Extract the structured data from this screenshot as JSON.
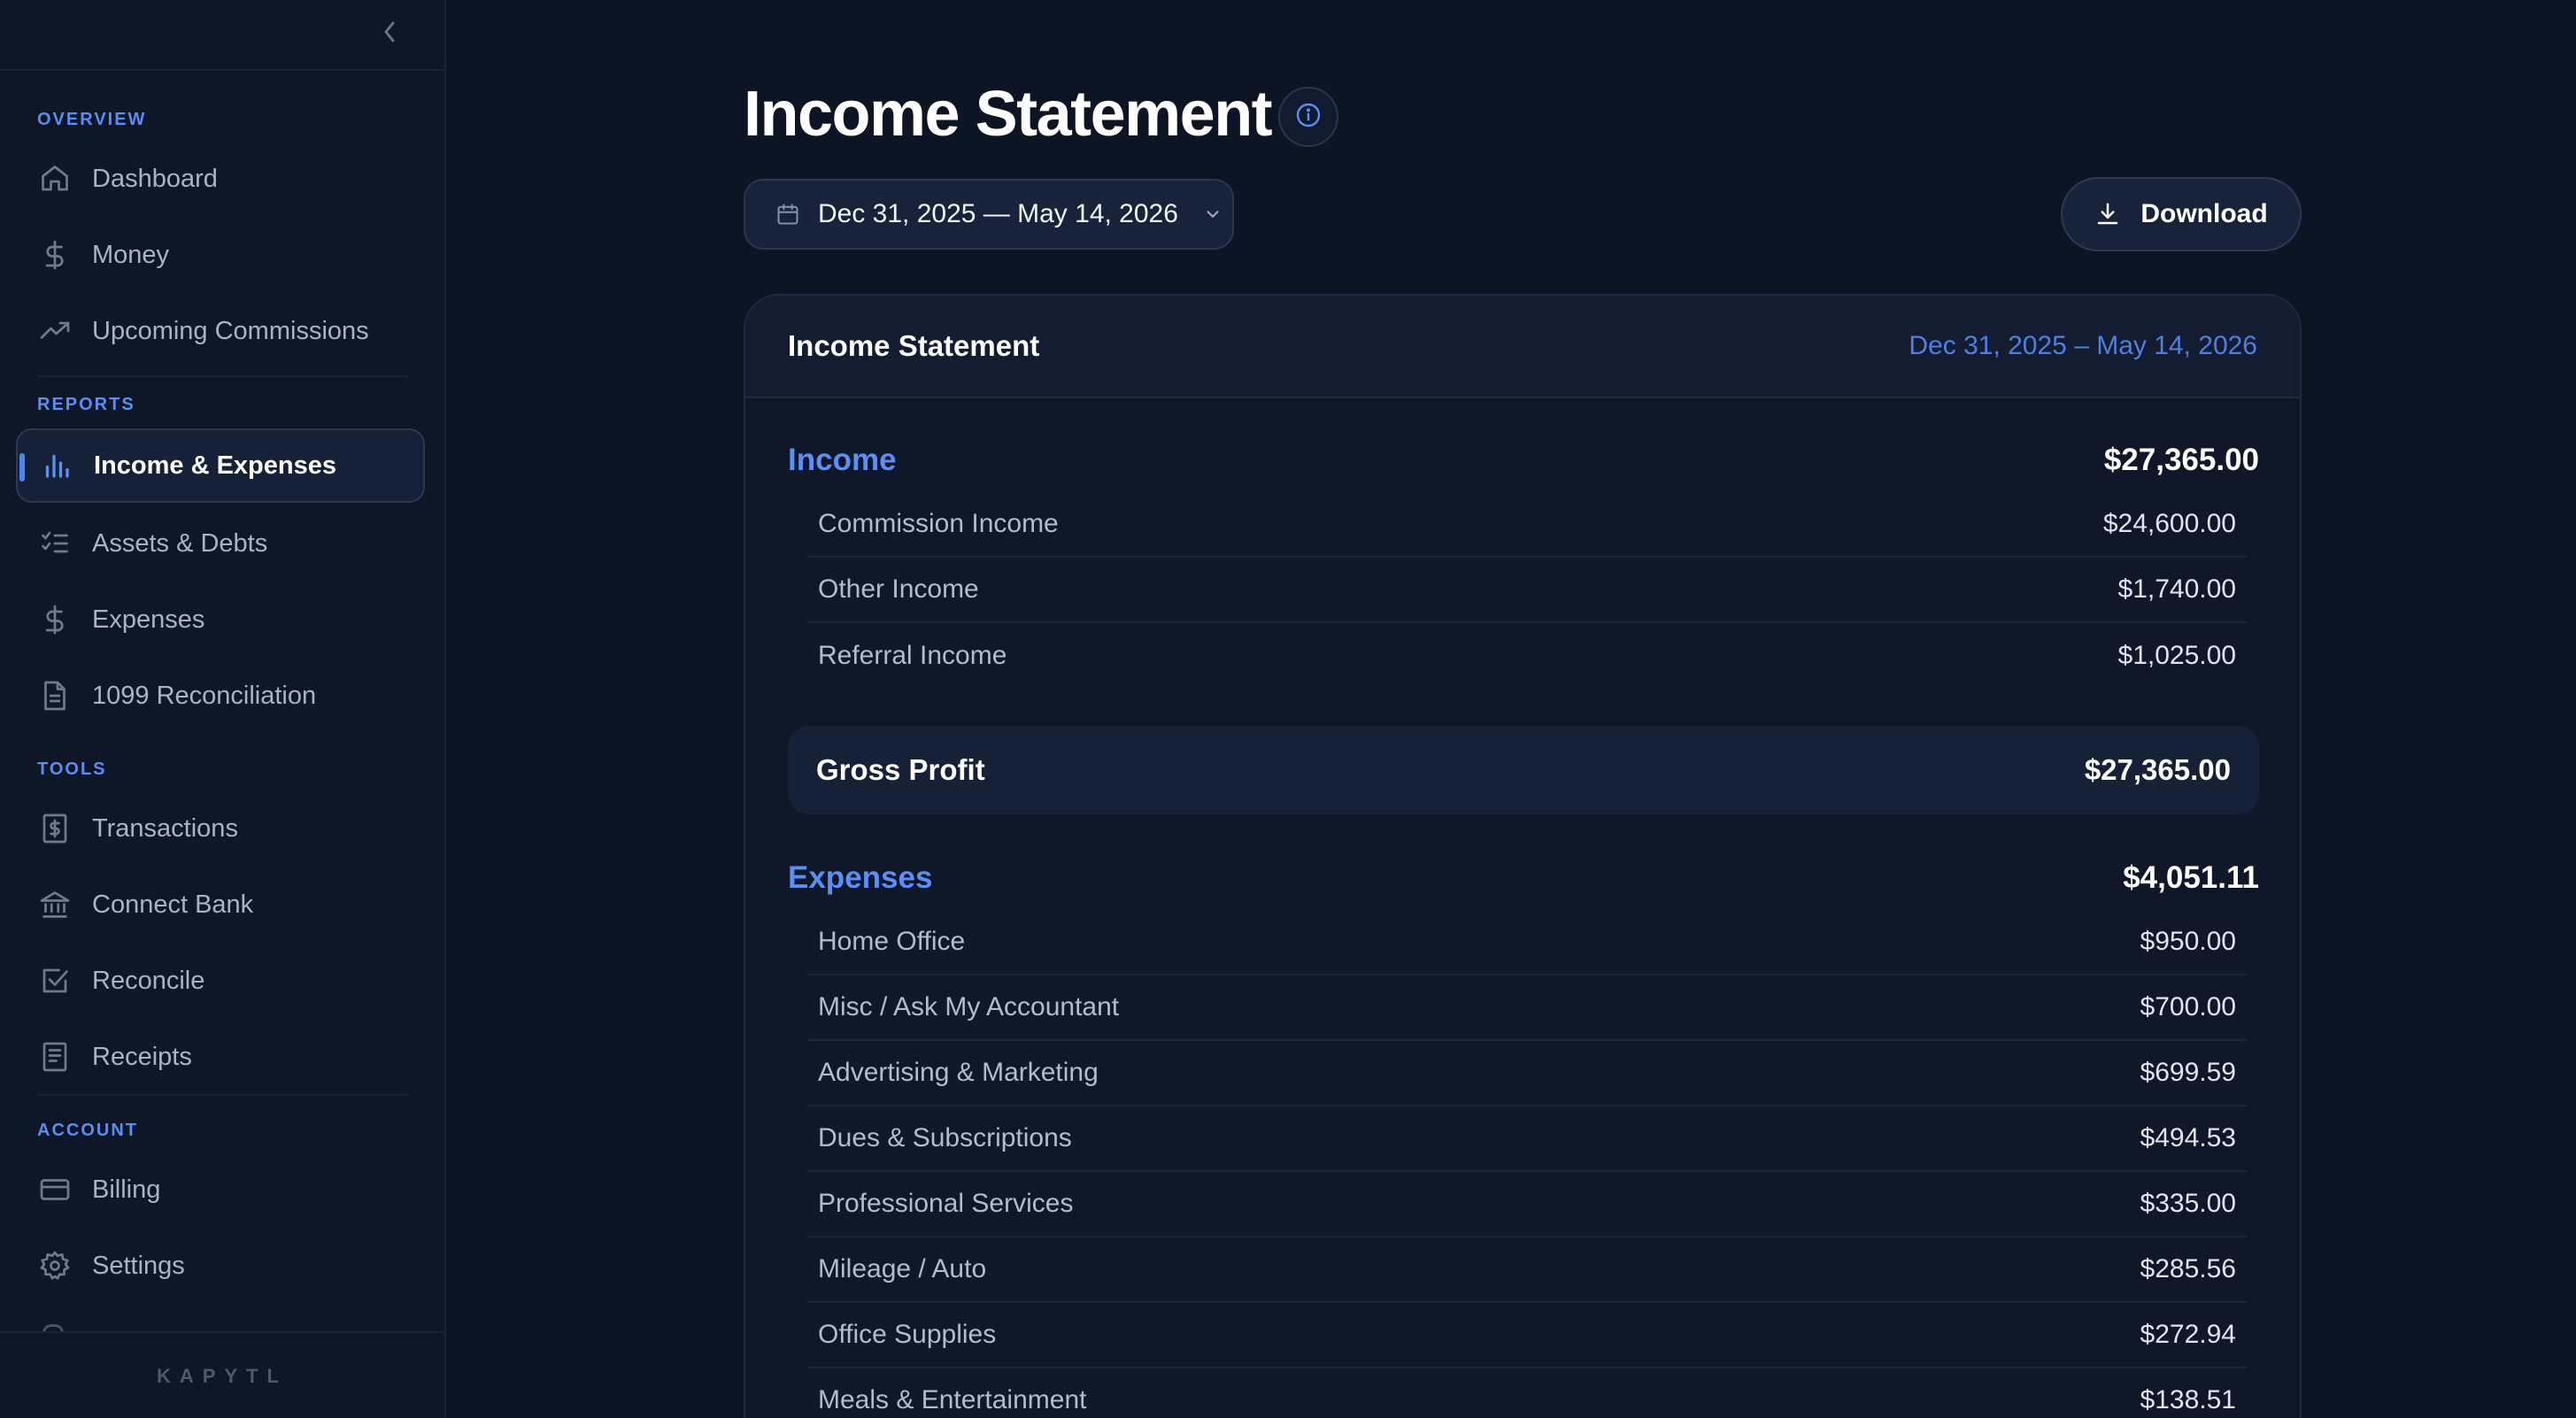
{
  "sidebar": {
    "sections": [
      {
        "label": "OVERVIEW"
      },
      {
        "label": "REPORTS"
      },
      {
        "label": "TOOLS"
      },
      {
        "label": "ACCOUNT"
      }
    ],
    "items": [
      {
        "label": "Dashboard",
        "icon": "home-icon"
      },
      {
        "label": "Money",
        "icon": "dollar-icon"
      },
      {
        "label": "Upcoming Commissions",
        "icon": "trending-up-icon"
      },
      {
        "label": "Income & Expenses",
        "icon": "bar-chart-icon",
        "active": true
      },
      {
        "label": "Assets & Debts",
        "icon": "checklist-icon"
      },
      {
        "label": "Expenses",
        "icon": "dollar-icon"
      },
      {
        "label": "1099 Reconciliation",
        "icon": "document-icon"
      },
      {
        "label": "Transactions",
        "icon": "receipt-dollar-icon"
      },
      {
        "label": "Connect Bank",
        "icon": "bank-icon"
      },
      {
        "label": "Reconcile",
        "icon": "check-square-icon"
      },
      {
        "label": "Receipts",
        "icon": "receipt-icon"
      },
      {
        "label": "Billing",
        "icon": "credit-card-icon"
      },
      {
        "label": "Settings",
        "icon": "gear-icon"
      }
    ],
    "brand": "KAPYTL"
  },
  "header": {
    "title": "Income Statement",
    "date_range": "Dec 31, 2025 — May 14, 2026",
    "download_label": "Download"
  },
  "statement": {
    "title": "Income Statement",
    "range": "Dec 31, 2025 – May 14, 2026",
    "income": {
      "label": "Income",
      "total": "$27,365.00",
      "rows": [
        {
          "name": "Commission Income",
          "amount": "$24,600.00"
        },
        {
          "name": "Other Income",
          "amount": "$1,740.00"
        },
        {
          "name": "Referral Income",
          "amount": "$1,025.00"
        }
      ]
    },
    "gross_profit": {
      "label": "Gross Profit",
      "amount": "$27,365.00"
    },
    "expenses": {
      "label": "Expenses",
      "total": "$4,051.11",
      "rows": [
        {
          "name": "Home Office",
          "amount": "$950.00"
        },
        {
          "name": "Misc / Ask My Accountant",
          "amount": "$700.00"
        },
        {
          "name": "Advertising & Marketing",
          "amount": "$699.59"
        },
        {
          "name": "Dues & Subscriptions",
          "amount": "$494.53"
        },
        {
          "name": "Professional Services",
          "amount": "$335.00"
        },
        {
          "name": "Mileage / Auto",
          "amount": "$285.56"
        },
        {
          "name": "Office Supplies",
          "amount": "$272.94"
        },
        {
          "name": "Meals & Entertainment",
          "amount": "$138.51"
        }
      ]
    }
  },
  "colors": {
    "background": "#0d1424",
    "sidebar": "#0e1628",
    "accent": "#5b8ff5",
    "section_label": "#5b8df0"
  }
}
